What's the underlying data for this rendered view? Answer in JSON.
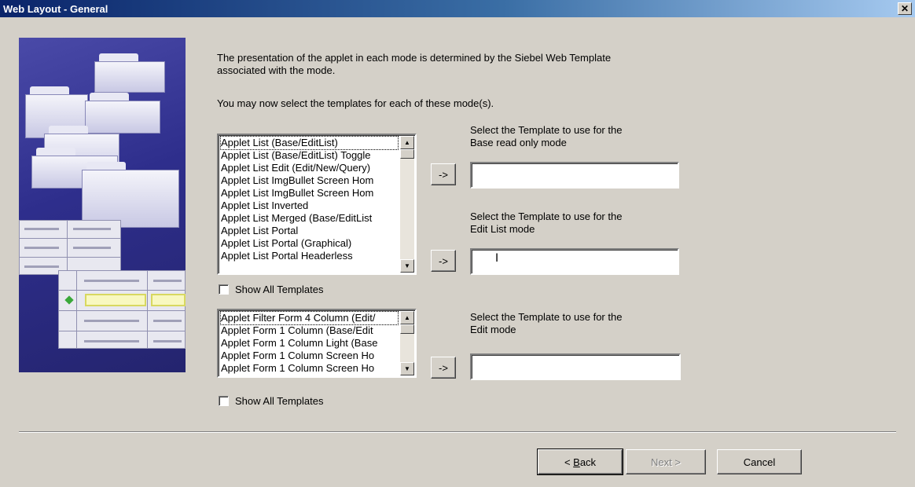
{
  "window": {
    "title": "Web Layout - General",
    "close_symbol": "✕"
  },
  "intro": {
    "line1": "The presentation of the applet in each mode is determined by the Siebel Web Template",
    "line2": "associated with the mode.",
    "line3": "You may now select the templates for each of these mode(s)."
  },
  "list1": {
    "items": [
      "Applet List (Base/EditList)",
      "Applet List (Base/EditList) Toggle",
      "Applet List Edit (Edit/New/Query)",
      "Applet List ImgBullet Screen Hom",
      "Applet List ImgBullet Screen Hom",
      "Applet List Inverted",
      "Applet List Merged (Base/EditList",
      "Applet List Portal",
      "Applet List Portal (Graphical)",
      "Applet List Portal Headerless"
    ],
    "show_all_label": "Show All Templates"
  },
  "list2": {
    "items": [
      "Applet Filter Form 4 Column (Edit/",
      "Applet Form 1 Column (Base/Edit",
      "Applet Form 1 Column Light (Base",
      "Applet Form 1 Column Screen Ho",
      "Applet Form 1 Column Screen Ho"
    ],
    "show_all_label": "Show All Templates"
  },
  "modes": [
    {
      "label_line1": "Select the Template to use for the",
      "label_line2": "Base read only mode",
      "value": ""
    },
    {
      "label_line1": "Select the Template to use for the",
      "label_line2": "Edit List mode",
      "value": ""
    },
    {
      "label_line1": "Select the Template to use for the",
      "label_line2": "Edit mode",
      "value": ""
    }
  ],
  "arrow_label": "->",
  "buttons": {
    "back_prefix": "< ",
    "back_accel": "B",
    "back_rest": "ack",
    "next": "Next >",
    "cancel": "Cancel"
  },
  "icons": {
    "scroll_up": "▲",
    "scroll_down": "▼",
    "text_cursor": "I"
  }
}
